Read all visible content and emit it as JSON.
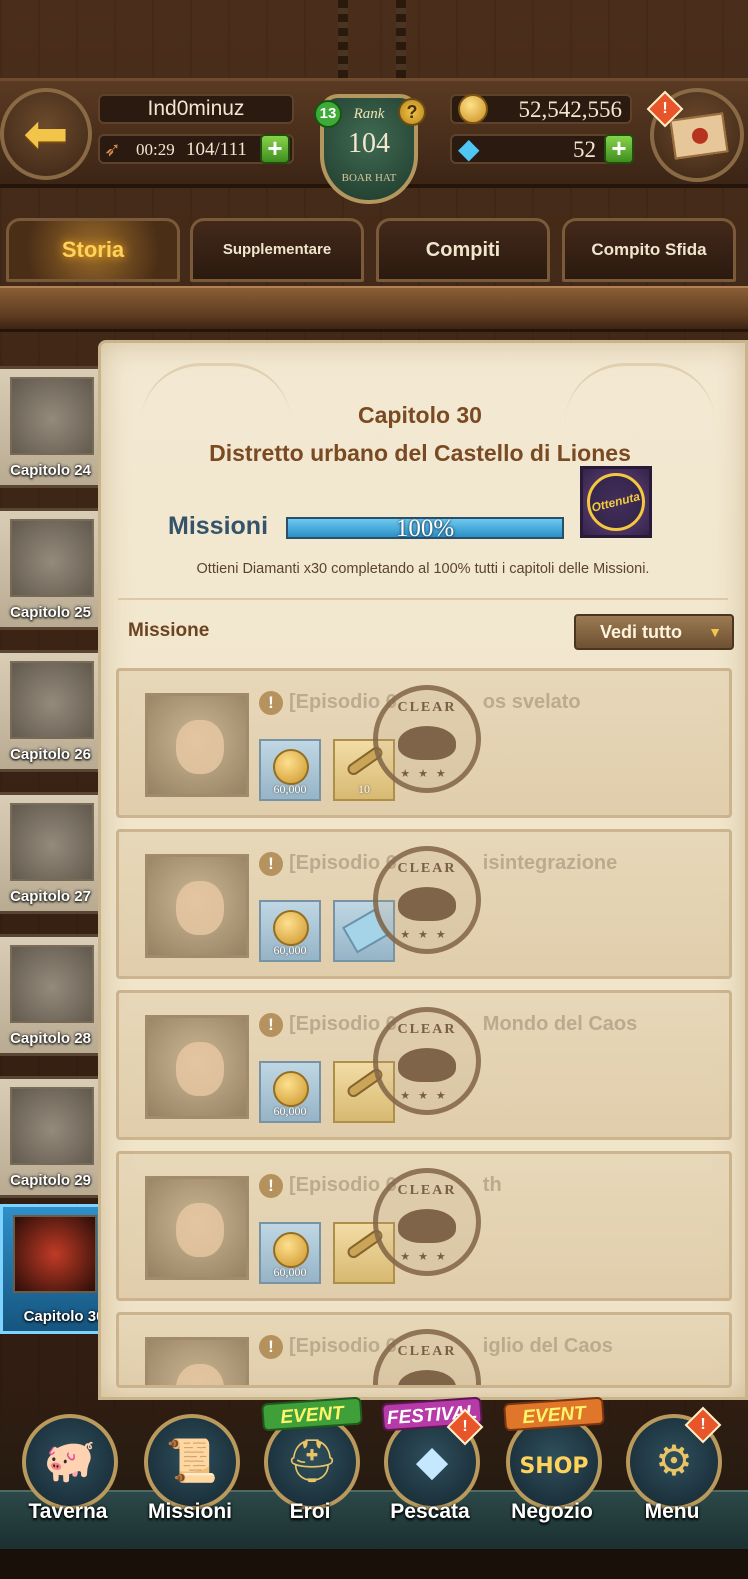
{
  "header": {
    "player_name": "Ind0minuz",
    "stamina_timer": "00:29",
    "stamina": "104/111",
    "rank_label": "Rank",
    "rank_value": "104",
    "rank_title": "BOAR HAT",
    "rank_level": "13",
    "gold": "52,542,556",
    "diamonds": "52"
  },
  "tabs": [
    {
      "label": "Storia",
      "active": true
    },
    {
      "label": "Supplementare",
      "active": false
    },
    {
      "label": "Compiti",
      "active": false
    },
    {
      "label": "Compito Sfida",
      "active": false
    }
  ],
  "chapters": [
    {
      "label": "Capitolo 24"
    },
    {
      "label": "Capitolo 25"
    },
    {
      "label": "Capitolo 26"
    },
    {
      "label": "Capitolo 27"
    },
    {
      "label": "Capitolo 28"
    },
    {
      "label": "Capitolo 29"
    },
    {
      "label": "Capitolo 30",
      "active": true
    }
  ],
  "chapter_detail": {
    "title": "Capitolo 30",
    "subtitle": "Distretto urbano del Castello di Liones",
    "missions_label": "Missioni",
    "progress_text": "100%",
    "progress_fraction": 1.0,
    "reward_badge": "Ottenuta",
    "note": "Ottieni Diamanti x30 completando al 100% tutti i capitoli delle Missioni.",
    "mission_header": "Missione",
    "view_all": "Vedi tutto"
  },
  "episodes": [
    {
      "title": "[Episodio 6",
      "title_end": "os svelato",
      "items": [
        {
          "type": "gold",
          "qty": "60,000"
        },
        {
          "type": "key",
          "qty": "10"
        }
      ],
      "stamp": "CLEAR"
    },
    {
      "title": "[Episodio 6",
      "title_end": "isintegrazione",
      "items": [
        {
          "type": "gold",
          "qty": "60,000"
        },
        {
          "type": "scroll",
          "qty": ""
        }
      ],
      "stamp": "CLEAR"
    },
    {
      "title": "[Episodio 6",
      "title_end": "Mondo del Caos",
      "items": [
        {
          "type": "gold",
          "qty": "60,000"
        },
        {
          "type": "key",
          "qty": ""
        }
      ],
      "stamp": "CLEAR"
    },
    {
      "title": "[Episodio 6",
      "title_end": "th",
      "items": [
        {
          "type": "gold",
          "qty": "60,000"
        },
        {
          "type": "key",
          "qty": ""
        }
      ],
      "stamp": "CLEAR"
    },
    {
      "title": "[Episodio 6",
      "title_end": "iglio del Caos",
      "items": [],
      "stamp": "CLEAR"
    }
  ],
  "bottom_nav": [
    {
      "label": "Taverna",
      "icon": "tavern-icon"
    },
    {
      "label": "Missioni",
      "icon": "scroll-icon"
    },
    {
      "label": "Eroi",
      "icon": "helmet-icon",
      "ribbon": "EVENT"
    },
    {
      "label": "Pescata",
      "icon": "crystal-icon",
      "ribbon": "FESTIVAL"
    },
    {
      "label": "Negozio",
      "icon": "shop-icon",
      "ribbon": "EVENT",
      "ribbon2": "SHOP"
    },
    {
      "label": "Menu",
      "icon": "gear-icon"
    }
  ],
  "colors": {
    "accent_gold": "#ffd25a",
    "progress_blue": "#2a8fc7",
    "alert_orange": "#e8552a",
    "plus_green": "#3f8e1e"
  }
}
